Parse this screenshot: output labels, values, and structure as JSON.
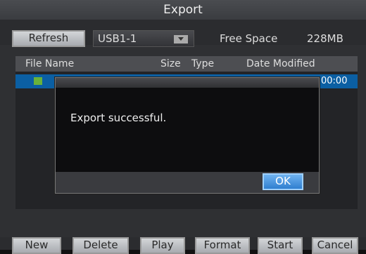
{
  "window": {
    "title": "Export"
  },
  "toolbar": {
    "refresh_label": "Refresh",
    "device_value": "USB1-1",
    "free_space_label": "Free Space",
    "free_space_value": "228MB"
  },
  "table": {
    "columns": [
      "File Name",
      "Size",
      "Type",
      "Date Modified"
    ],
    "rows": [
      {
        "time_fragment": "00:00"
      }
    ]
  },
  "dialog": {
    "message": "Export successful.",
    "ok_label": "OK"
  },
  "footer": {
    "buttons": [
      "New",
      "Delete",
      "Play",
      "Format",
      "Start",
      "Cancel"
    ]
  },
  "colors": {
    "selection": "#0b5fa3",
    "ok_button": "#3f8edc"
  }
}
